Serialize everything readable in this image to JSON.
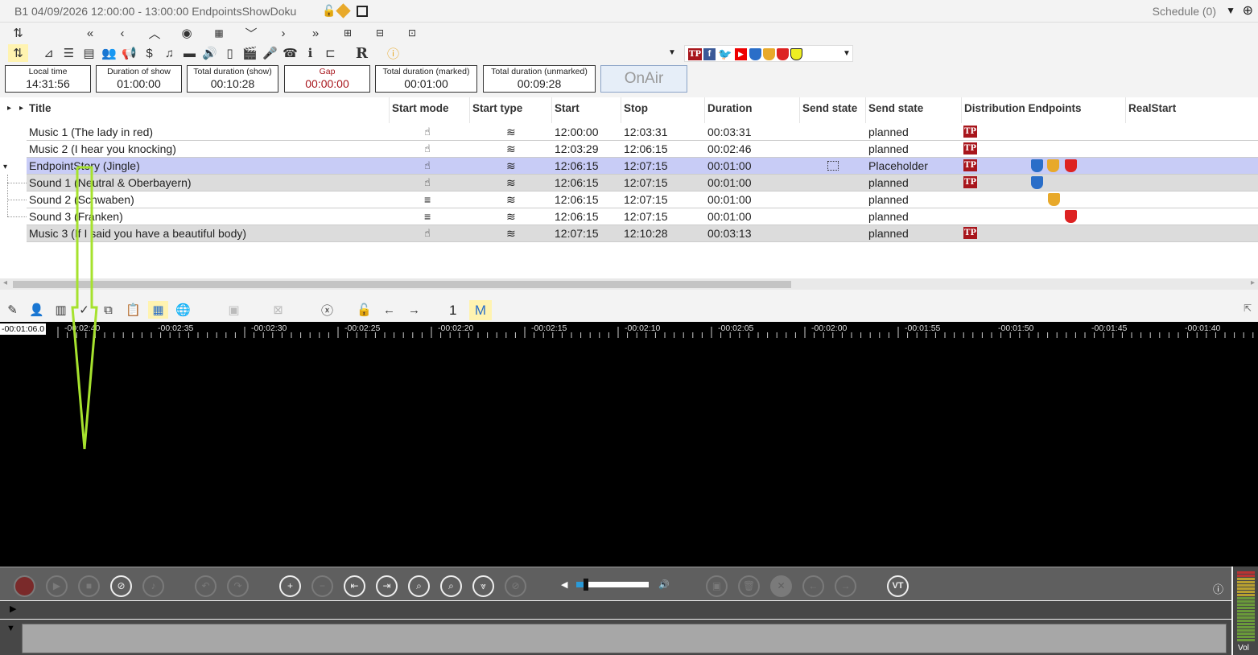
{
  "titlebar": {
    "title": "B1 04/09/2026 12:00:00 - 13:00:00 EndpointsShowDoku",
    "schedule": "Schedule (0)"
  },
  "kpis": [
    {
      "label": "Local time",
      "value": "14:31:56"
    },
    {
      "label": "Duration of show",
      "value": "01:00:00"
    },
    {
      "label": "Total duration (show)",
      "value": "00:10:28"
    },
    {
      "label": "Gap",
      "value": "00:00:00"
    },
    {
      "label": "Total duration (marked)",
      "value": "00:01:00"
    },
    {
      "label": "Total duration (unmarked)",
      "value": "00:09:28"
    }
  ],
  "onair_label": "OnAir",
  "columns": [
    "Title",
    "Start mode",
    "Start type",
    "Start",
    "Stop",
    "Duration",
    "Send state",
    "Send state",
    "Distribution Endpoints",
    "RealStart"
  ],
  "rows": [
    {
      "title": "Music 1 (The lady in red)",
      "start": "12:00:00",
      "stop": "12:03:31",
      "duration": "00:03:31",
      "state": "planned"
    },
    {
      "title": "Music 2 (I hear you knocking)",
      "start": "12:03:29",
      "stop": "12:06:15",
      "duration": "00:02:46",
      "state": "planned"
    },
    {
      "title": "EndpointStory (Jingle)",
      "start": "12:06:15",
      "stop": "12:07:15",
      "duration": "00:01:00",
      "state": "Placeholder"
    },
    {
      "title": "Sound 1 (Neutral & Oberbayern)",
      "start": "12:06:15",
      "stop": "12:07:15",
      "duration": "00:01:00",
      "state": "planned"
    },
    {
      "title": "Sound 2 (Schwaben)",
      "start": "12:06:15",
      "stop": "12:07:15",
      "duration": "00:01:00",
      "state": "planned"
    },
    {
      "title": "Sound 3 (Franken)",
      "start": "12:06:15",
      "stop": "12:07:15",
      "duration": "00:01:00",
      "state": "planned"
    },
    {
      "title": "Music 3 (If I said you have a beautiful body)",
      "start": "12:07:15",
      "stop": "12:10:28",
      "duration": "00:03:13",
      "state": "planned"
    }
  ],
  "tp_label": "TP",
  "ruler": {
    "current": "-00:01:06.0",
    "ticks": [
      "-00:02:40",
      "-00:02:35",
      "-00:02:30",
      "-00:02:25",
      "-00:02:20",
      "-00:02:15",
      "-00:02:10",
      "-00:02:05",
      "-00:02:00",
      "-00:01:55",
      "-00:01:50",
      "-00:01:45",
      "-00:01:40"
    ]
  },
  "wavetools": {
    "track_number": "1",
    "mode": "M"
  },
  "player": {
    "vt_label": "VT",
    "vol_label": "Vol"
  },
  "colors": {
    "selected_row": "#c8ccf6",
    "tp_red": "#a8161c",
    "highlight_yellow": "#fff3b0",
    "arrow_green": "#a6e22e"
  }
}
